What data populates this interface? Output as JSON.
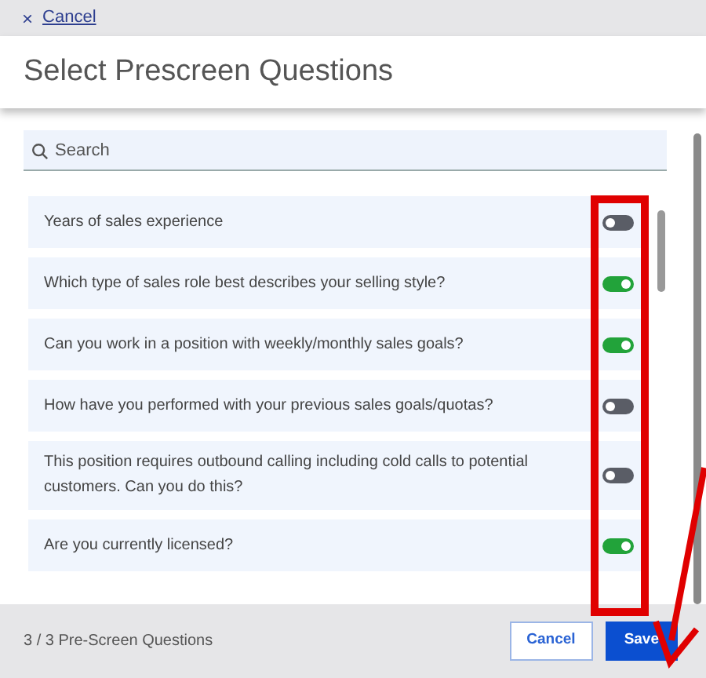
{
  "top_bar": {
    "close_icon": "×",
    "link": "Cancel"
  },
  "header": {
    "title": "Select Prescreen Questions"
  },
  "search": {
    "placeholder": "Search"
  },
  "questions": [
    {
      "text": "Years of sales experience",
      "on": false
    },
    {
      "text": "Which type of sales role best describes your selling style?",
      "on": true
    },
    {
      "text": "Can you work in a position with weekly/monthly sales goals?",
      "on": true
    },
    {
      "text": "How have you performed with your previous sales goals/quotas?",
      "on": false
    },
    {
      "text": "This position requires outbound calling including cold calls to potential customers. Can you do this?",
      "on": false
    },
    {
      "text": "Are you currently licensed?",
      "on": true
    }
  ],
  "footer": {
    "count": "3 / 3 Pre-Screen Questions",
    "buttons": [
      {
        "label": "Cancel",
        "kind": "secondary"
      },
      {
        "label": "Save",
        "kind": "primary"
      }
    ]
  },
  "annotations": {
    "highlight_box": true,
    "arrow": true
  }
}
